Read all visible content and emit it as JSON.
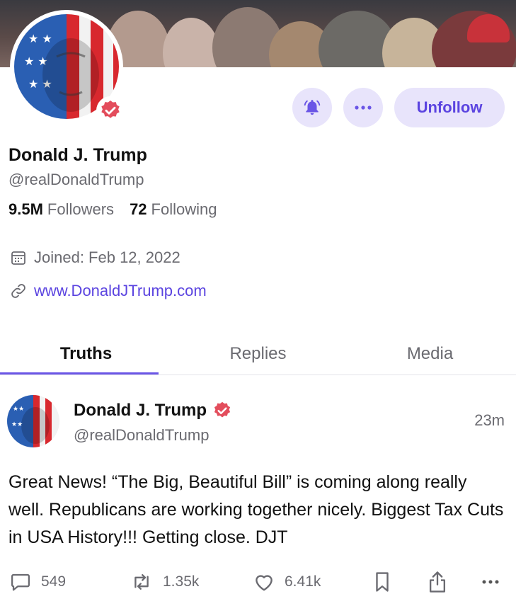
{
  "profile": {
    "name": "Donald J. Trump",
    "handle": "@realDonaldTrump",
    "followers_count": "9.5M",
    "followers_label": "Followers",
    "following_count": "72",
    "following_label": "Following",
    "joined": "Joined: Feb 12, 2022",
    "website": "www.DonaldJTrump.com"
  },
  "actions": {
    "unfollow_label": "Unfollow",
    "notify_icon": "bell-icon",
    "more_icon": "more-horizontal-icon"
  },
  "tabs": [
    {
      "label": "Truths",
      "active": true
    },
    {
      "label": "Replies",
      "active": false
    },
    {
      "label": "Media",
      "active": false
    }
  ],
  "post": {
    "name": "Donald J. Trump",
    "handle": "@realDonaldTrump",
    "time": "23m",
    "text": "Great News! “The Big, Beautiful Bill” is coming along really well. Republicans are working together nicely. Biggest Tax Cuts in USA History!!! Getting close. DJT",
    "replies": "549",
    "retruths": "1.35k",
    "likes": "6.41k"
  },
  "colors": {
    "accent": "#5b44e0",
    "accent_light": "#e8e4fb",
    "verified": "#e34d5c"
  }
}
